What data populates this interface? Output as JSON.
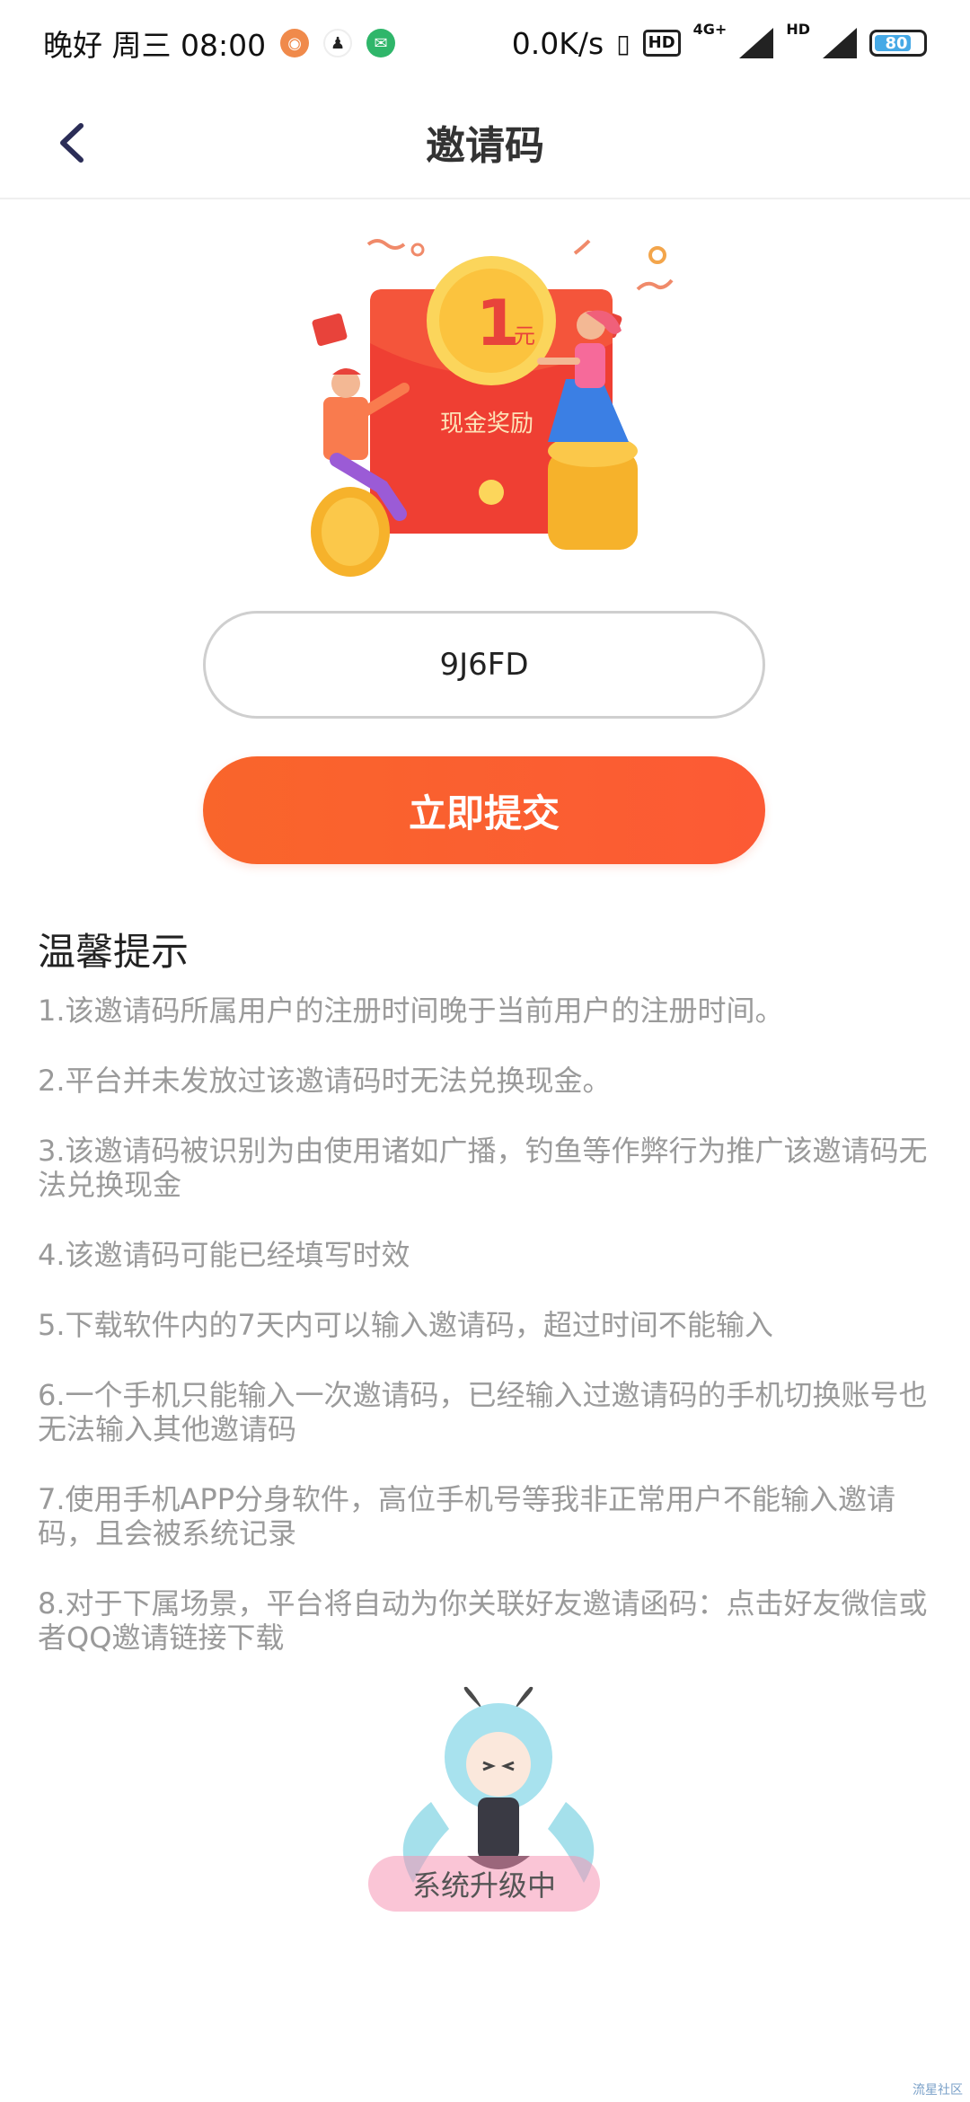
{
  "status_bar": {
    "left_text": "晚好 周三 08:00",
    "network_speed": "0.0K/s",
    "hd_badge": "HD",
    "network_type": "4G+",
    "hd2_badge": "HD",
    "battery_level": "80"
  },
  "nav": {
    "title": "邀请码"
  },
  "hero": {
    "amount": "1",
    "unit": "元",
    "caption": "现金奖励"
  },
  "form": {
    "invite_code_value": "9J6FD",
    "submit_label": "立即提交"
  },
  "tips": {
    "title": "温馨提示",
    "items": [
      "1.该邀请码所属用户的注册时间晚于当前用户的注册时间。",
      "2.平台并未发放过该邀请码时无法兑换现金。",
      "3.该邀请码被识别为由使用诸如广播，钓鱼等作弊行为推广该邀请码无法兑换现金",
      "4.该邀请码可能已经填写时效",
      "5.下载软件内的7天内可以输入邀请码，超过时间不能输入",
      "6.一个手机只能输入一次邀请码，已经输入过邀请码的手机切换账号也无法输入其他邀请码",
      "7.使用手机APP分身软件，高位手机号等我非正常用户不能输入邀请码，且会被系统记录",
      "8.对于下属场景，平台将自动为你关联好友邀请函码：点击好友微信或者QQ邀请链接下载"
    ]
  },
  "floating": {
    "badge_label": "系统升级中"
  },
  "watermark": "流星社区"
}
